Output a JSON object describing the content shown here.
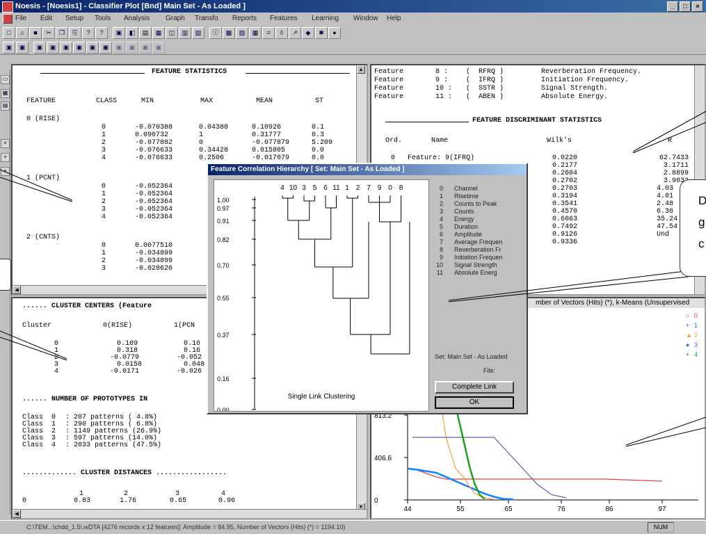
{
  "window": {
    "title": "Noesis - [Noesis1] - Classifier Plot [Bnd] Main Set - As Loaded ]"
  },
  "menu": [
    "File",
    "Edit",
    "Setup",
    "Tools",
    "Analysis",
    "Graph",
    "Transfo",
    "Reports",
    "Features",
    "Learning",
    "Window",
    "Help"
  ],
  "feature_stats": {
    "title": "FEATURE STATISTICS",
    "headers": [
      "FEATURE",
      "CLASS",
      "MIN",
      "MAX",
      "MEAN",
      "ST"
    ],
    "groups": [
      {
        "name": "0 (RISE)",
        "rows": [
          [
            "0",
            "-0.070388",
            "0.04388",
            "0.10926",
            "0.1"
          ],
          [
            "1",
            "0.090732",
            "1",
            "0.31777",
            "0.3"
          ],
          [
            "2",
            "-0.077882",
            "0",
            "-0.077879",
            "5.209"
          ],
          [
            "3",
            "-0.076633",
            "0.34428",
            "0.015805",
            "0.0"
          ],
          [
            "4",
            "-0.076633",
            "0.2506",
            "-0.017079",
            "0.0"
          ]
        ]
      },
      {
        "name": "1 (PCNT)",
        "rows": [
          [
            "0",
            "-0.052364",
            "",
            "",
            ""
          ],
          [
            "1",
            "-0.052364",
            "",
            "",
            ""
          ],
          [
            "2",
            "-0.052364",
            "",
            "",
            ""
          ],
          [
            "3",
            "-0.052364",
            "",
            "",
            ""
          ],
          [
            "4",
            "-0.052364",
            "",
            "",
            ""
          ]
        ]
      },
      {
        "name": "2 (CNTS)",
        "rows": [
          [
            "0",
            "0.0077510",
            "",
            "",
            ""
          ],
          [
            "1",
            "-0.034899",
            "",
            "",
            ""
          ],
          [
            "2",
            "-0.034899",
            "",
            "",
            ""
          ],
          [
            "3",
            "-0.028626",
            "",
            "",
            ""
          ]
        ]
      }
    ]
  },
  "feature_list": [
    [
      "Feature",
      "8",
      "RFRQ",
      "Reverberation Frequency."
    ],
    [
      "Feature",
      "9",
      "IFRQ",
      "Initiation Frequency."
    ],
    [
      "Feature",
      "10",
      "SSTR",
      "Signal Strength."
    ],
    [
      "Feature",
      "11",
      "ABEN",
      "Absolute Energy."
    ]
  ],
  "discriminant": {
    "title": "FEATURE DISCRIMINANT STATISTICS",
    "headers": [
      "Ord.",
      "Name",
      "Wilk's",
      "R"
    ],
    "first_row": [
      "0",
      "Feature: 9(IFRQ)",
      "0.0220",
      "62.7433"
    ],
    "wilks": [
      "0.2177",
      "0.2604",
      "0.2702",
      "0.2703",
      "0.3194",
      "0.3541",
      "0.4570",
      "0.6063",
      "0.7492",
      "0.9126",
      "0.9336"
    ],
    "r": [
      "3.1711",
      "2.8899",
      "3.9032",
      "4.03",
      "4.01",
      "2.48",
      "6.36",
      "35.24",
      "47.54",
      "Und"
    ]
  },
  "cluster_centers": {
    "title": "...... CLUSTER CENTERS (Feature",
    "headers": [
      "Cluster",
      "0(RISE)",
      "1(PCN"
    ],
    "rows": [
      [
        "0",
        "0.109",
        "0.16"
      ],
      [
        "1",
        "0.318",
        "0.16"
      ],
      [
        "2",
        "-0.0779",
        "-0.052"
      ],
      [
        "3",
        "0.0158",
        "0.048"
      ],
      [
        "4",
        "-0.0171",
        "-0.026"
      ]
    ]
  },
  "prototypes": {
    "title": "...... NUMBER OF PROTOTYPES IN",
    "rows": [
      [
        "Class",
        "0",
        ":",
        "207 patterns (",
        "4.8%)"
      ],
      [
        "Class",
        "1",
        ":",
        "290 patterns (",
        "6.8%)"
      ],
      [
        "Class",
        "2",
        ":",
        "1149 patterns (26.9%)",
        ""
      ],
      [
        "Class",
        "3",
        ":",
        "597 patterns (14.0%)",
        ""
      ],
      [
        "Class",
        "4",
        ":",
        "2033 patterns (47.5%)",
        ""
      ]
    ]
  },
  "distances": {
    "title": "............. CLUSTER DISTANCES .................",
    "header": [
      "1",
      "2",
      "3",
      "4"
    ],
    "row": [
      "0",
      "0.83",
      "1.76",
      "0.65",
      "0.96"
    ]
  },
  "dialog": {
    "title": "Feature Correlation Hierarchy [ Set: Main Set - As Loaded ]",
    "leaf_order": [
      "4",
      "10",
      "3",
      "5",
      "6",
      "11",
      "1",
      "2",
      "7",
      "9",
      "0",
      "8"
    ],
    "y_ticks": [
      "1.00",
      "0.97",
      "0.91",
      "0.82",
      "0.70",
      "0.55",
      "0.37",
      "0.16",
      "0.00"
    ],
    "bottom_label": "Single Link Clustering",
    "features": [
      [
        "0",
        "Channel"
      ],
      [
        "1",
        "Risetime"
      ],
      [
        "2",
        "Counts to Peak"
      ],
      [
        "3",
        "Counts"
      ],
      [
        "4",
        "Energy"
      ],
      [
        "5",
        "Duration"
      ],
      [
        "6",
        "Amplitude"
      ],
      [
        "7",
        "Average Frequen"
      ],
      [
        "8",
        "Reverberation Fr"
      ],
      [
        "9",
        "Initiation Frequen"
      ],
      [
        "10",
        "Signal Strength"
      ],
      [
        "11",
        "Absolute Energ"
      ]
    ],
    "set_label": "Set: Main Set - As Loaded",
    "file_label": "File:",
    "complete_link_btn": "Complete Link",
    "ok_btn": "OK"
  },
  "graph": {
    "title": "mber of Vectors (Hits) (*), k-Means (Unsupervised",
    "legend": [
      "0",
      "1",
      "2",
      "3",
      "4"
    ],
    "legend_colors": [
      "#e04040",
      "#4060e0",
      "#f0a040",
      "#6060a0",
      "#20a020"
    ]
  },
  "chart_data": {
    "type": "line",
    "x_ticks": [
      "44",
      "55",
      "65",
      "76",
      "86",
      "97"
    ],
    "y_ticks": [
      "0",
      "406.6",
      "813.2"
    ],
    "series": [
      {
        "name": "0",
        "color": "#e04040",
        "x": [
          45,
          47,
          50,
          52,
          55,
          65,
          75,
          85,
          97
        ],
        "y": [
          300,
          270,
          220,
          200,
          200,
          200,
          200,
          200,
          180
        ]
      },
      {
        "name": "1",
        "color": "#1080ff",
        "x": [
          44,
          46,
          50,
          53,
          55,
          57,
          60,
          62,
          64,
          66
        ],
        "y": [
          300,
          290,
          260,
          200,
          160,
          120,
          60,
          30,
          10,
          5
        ]
      },
      {
        "name": "2",
        "color": "#f0a040",
        "x": [
          51,
          52,
          54,
          56,
          57,
          58,
          60,
          62
        ],
        "y": [
          900,
          600,
          300,
          200,
          120,
          60,
          20,
          5
        ]
      },
      {
        "name": "3",
        "color": "#6060a0",
        "x": [
          45,
          57,
          62,
          65,
          68,
          71,
          74,
          77
        ],
        "y": [
          600,
          600,
          600,
          450,
          300,
          150,
          50,
          20
        ]
      },
      {
        "name": "4",
        "color": "#20a020",
        "x": [
          53,
          54,
          55,
          56,
          57,
          58,
          59,
          60
        ],
        "y": [
          1000,
          900,
          700,
          500,
          300,
          150,
          50,
          10
        ]
      }
    ]
  },
  "callout_texts": {
    "right_mid": "D\ng\nc"
  },
  "status": {
    "text": "C:\\TEM...\\chdd_1.5\\.wDTA [4276 records x 12 features]: Amplitude = 84.95, Number of Vectors (Hits) (*) = 1194.10)",
    "mode": "NUM"
  }
}
